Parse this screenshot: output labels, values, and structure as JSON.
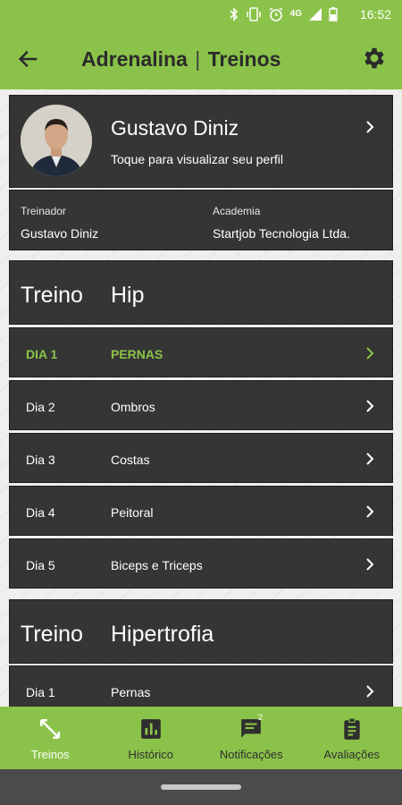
{
  "status_bar": {
    "time": "16:52",
    "network": "4G"
  },
  "app_bar": {
    "title_app": "Adrenalina",
    "title_separator": "|",
    "title_section": "Treinos"
  },
  "profile": {
    "name": "Gustavo Diniz",
    "subtitle": "Toque para visualizar seu perfil"
  },
  "info": {
    "trainer_label": "Treinador",
    "trainer_value": "Gustavo Diniz",
    "gym_label": "Academia",
    "gym_value": "Startjob Tecnologia Ltda."
  },
  "workouts": [
    {
      "label": "Treino",
      "name": "Hip",
      "days": [
        {
          "day": "DIA 1",
          "muscle": "PERNAS",
          "active": true
        },
        {
          "day": "Dia 2",
          "muscle": "Ombros"
        },
        {
          "day": "Dia 3",
          "muscle": "Costas"
        },
        {
          "day": "Dia 4",
          "muscle": "Peitoral"
        },
        {
          "day": "Dia 5",
          "muscle": "Biceps e Triceps"
        }
      ]
    },
    {
      "label": "Treino",
      "name": "Hipertrofia",
      "days": [
        {
          "day": "Dia 1",
          "muscle": "Pernas"
        }
      ]
    }
  ],
  "bottom_nav": [
    {
      "label": "Treinos",
      "icon": "arrows-expand-icon",
      "active": true
    },
    {
      "label": "Histórico",
      "icon": "bar-chart-icon"
    },
    {
      "label": "Notificações",
      "icon": "chat-icon",
      "badge": "2"
    },
    {
      "label": "Avaliações",
      "icon": "clipboard-icon"
    }
  ],
  "colors": {
    "accent": "#8bc34a",
    "card": "#353535",
    "text_dark": "#2b2b2b"
  }
}
